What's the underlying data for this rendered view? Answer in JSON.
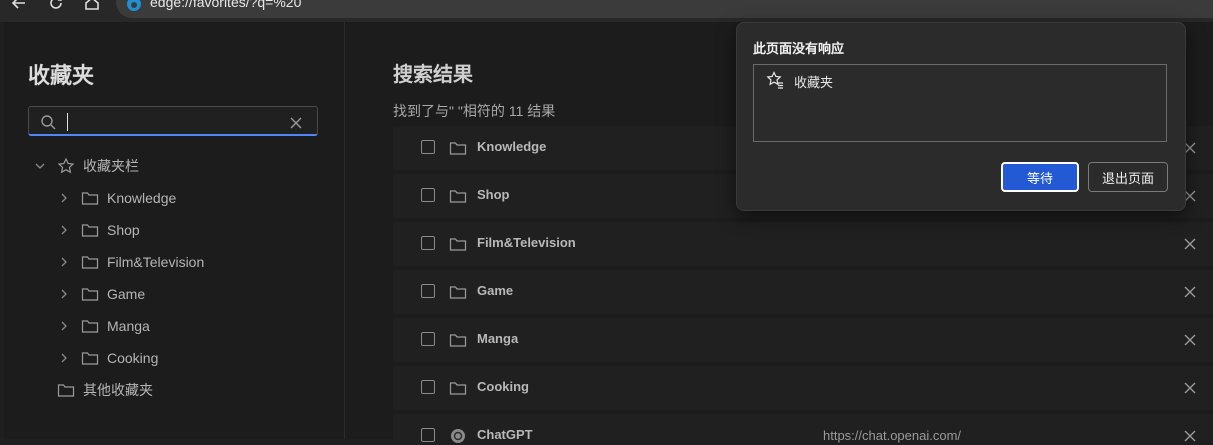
{
  "browser": {
    "address_url": "edge://favorites/?q=%20"
  },
  "sidebar": {
    "title": "收藏夹",
    "search_value": "",
    "root_label": "收藏夹栏",
    "folders": [
      {
        "label": "Knowledge"
      },
      {
        "label": "Shop"
      },
      {
        "label": "Film&Television"
      },
      {
        "label": "Game"
      },
      {
        "label": "Manga"
      },
      {
        "label": "Cooking"
      }
    ],
    "other_label": "其他收藏夹"
  },
  "main": {
    "title": "搜索结果",
    "summary_text": "找到了与\" \"相符的",
    "summary_count": "11 结果",
    "results": [
      {
        "name": "Knowledge",
        "url": "",
        "icon": "folder-icon"
      },
      {
        "name": "Shop",
        "url": "",
        "icon": "folder-icon"
      },
      {
        "name": "Film&Television",
        "url": "",
        "icon": "folder-icon"
      },
      {
        "name": "Game",
        "url": "",
        "icon": "folder-icon"
      },
      {
        "name": "Manga",
        "url": "",
        "icon": "folder-icon"
      },
      {
        "name": "Cooking",
        "url": "",
        "icon": "folder-icon"
      },
      {
        "name": "ChatGPT",
        "url": "https://chat.openai.com/",
        "icon": "chatgpt-icon"
      }
    ]
  },
  "dialog": {
    "title": "此页面没有响应",
    "item_label": "收藏夹",
    "wait_label": "等待",
    "exit_label": "退出页面"
  },
  "colors": {
    "accent": "#2459d6",
    "focus_underline": "#4f86f7",
    "background": "#1c1c1c"
  }
}
